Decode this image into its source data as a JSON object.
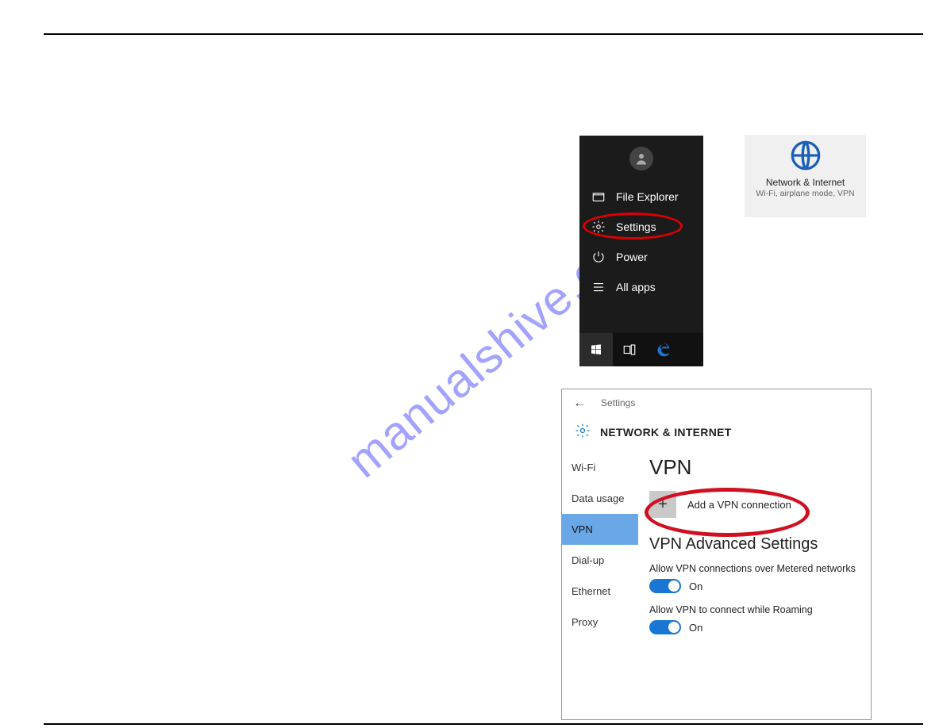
{
  "watermark": "manualshive.com",
  "start_menu": {
    "items": [
      {
        "label": "File Explorer"
      },
      {
        "label": "Settings"
      },
      {
        "label": "Power"
      },
      {
        "label": "All apps"
      }
    ]
  },
  "tile": {
    "title": "Network & Internet",
    "subtitle": "Wi-Fi, airplane mode, VPN"
  },
  "settings_window": {
    "titlebar_label": "Settings",
    "header": "NETWORK & INTERNET",
    "sidebar": [
      "Wi-Fi",
      "Data usage",
      "VPN",
      "Dial-up",
      "Ethernet",
      "Proxy"
    ],
    "main": {
      "heading": "VPN",
      "add_button_label": "Add a VPN connection",
      "advanced_heading": "VPN Advanced Settings",
      "setting1_label": "Allow VPN connections over Metered networks",
      "setting2_label": "Allow VPN to connect while Roaming",
      "toggle_on_label": "On"
    }
  }
}
